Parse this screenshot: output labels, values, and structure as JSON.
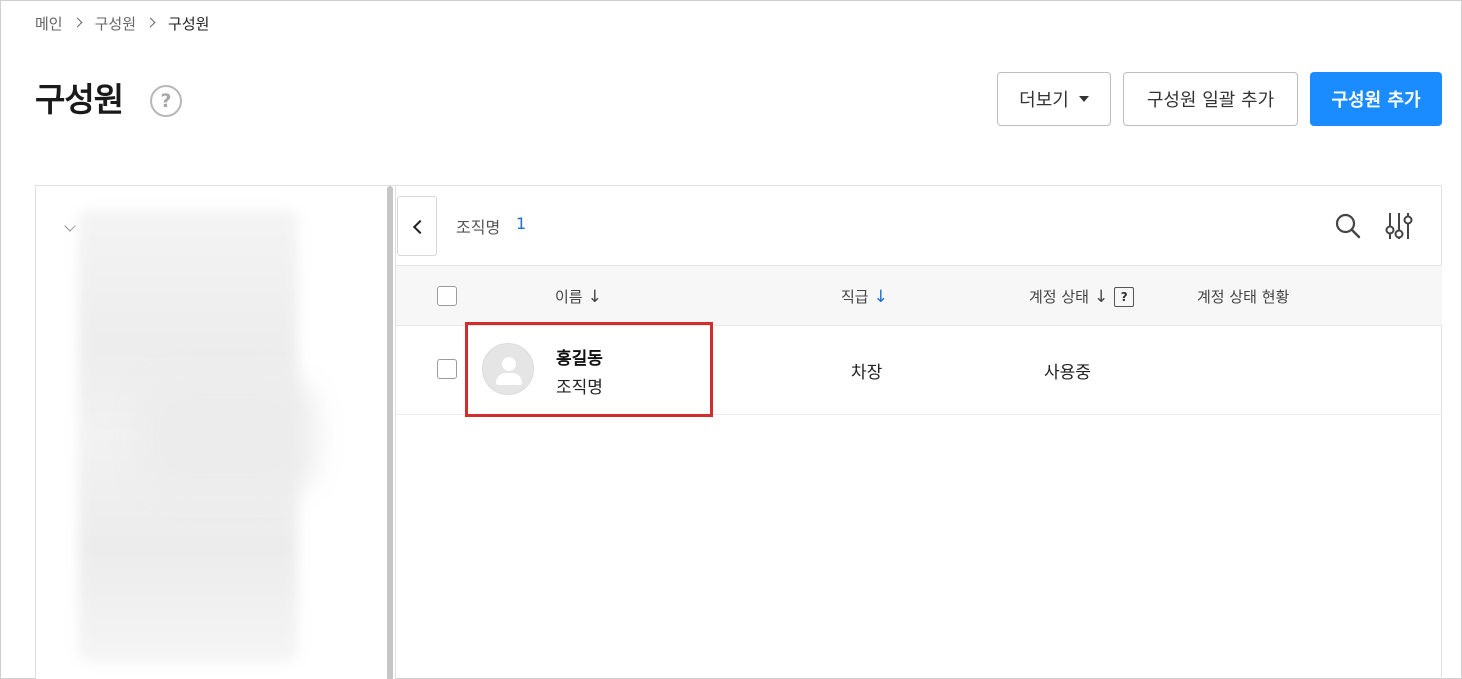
{
  "breadcrumb": {
    "items": [
      "메인",
      "구성원",
      "구성원"
    ]
  },
  "header": {
    "title": "구성원",
    "help_icon": "?",
    "buttons": {
      "more": "더보기",
      "bulk_add": "구성원 일괄 추가",
      "add": "구성원 추가"
    }
  },
  "colors": {
    "primary": "#1a8cff",
    "link": "#1a6fd8",
    "highlight": "#d22c2c"
  },
  "list": {
    "org_label": "조직명",
    "count": "1",
    "columns": {
      "name": "이름",
      "name_sort": "↓",
      "rank": "직급",
      "rank_sort": "↓",
      "status": "계정 상태",
      "status_sort": "↓",
      "status_help": "?",
      "status_detail": "계정 상태 현황"
    },
    "rows": [
      {
        "name": "홍길동",
        "org": "조직명",
        "rank": "차장",
        "status": "사용중"
      }
    ]
  },
  "icons": {
    "collapse": "chevron-left-icon",
    "search": "search-icon",
    "filter": "filter-sliders-icon",
    "avatar": "user-avatar-icon"
  }
}
